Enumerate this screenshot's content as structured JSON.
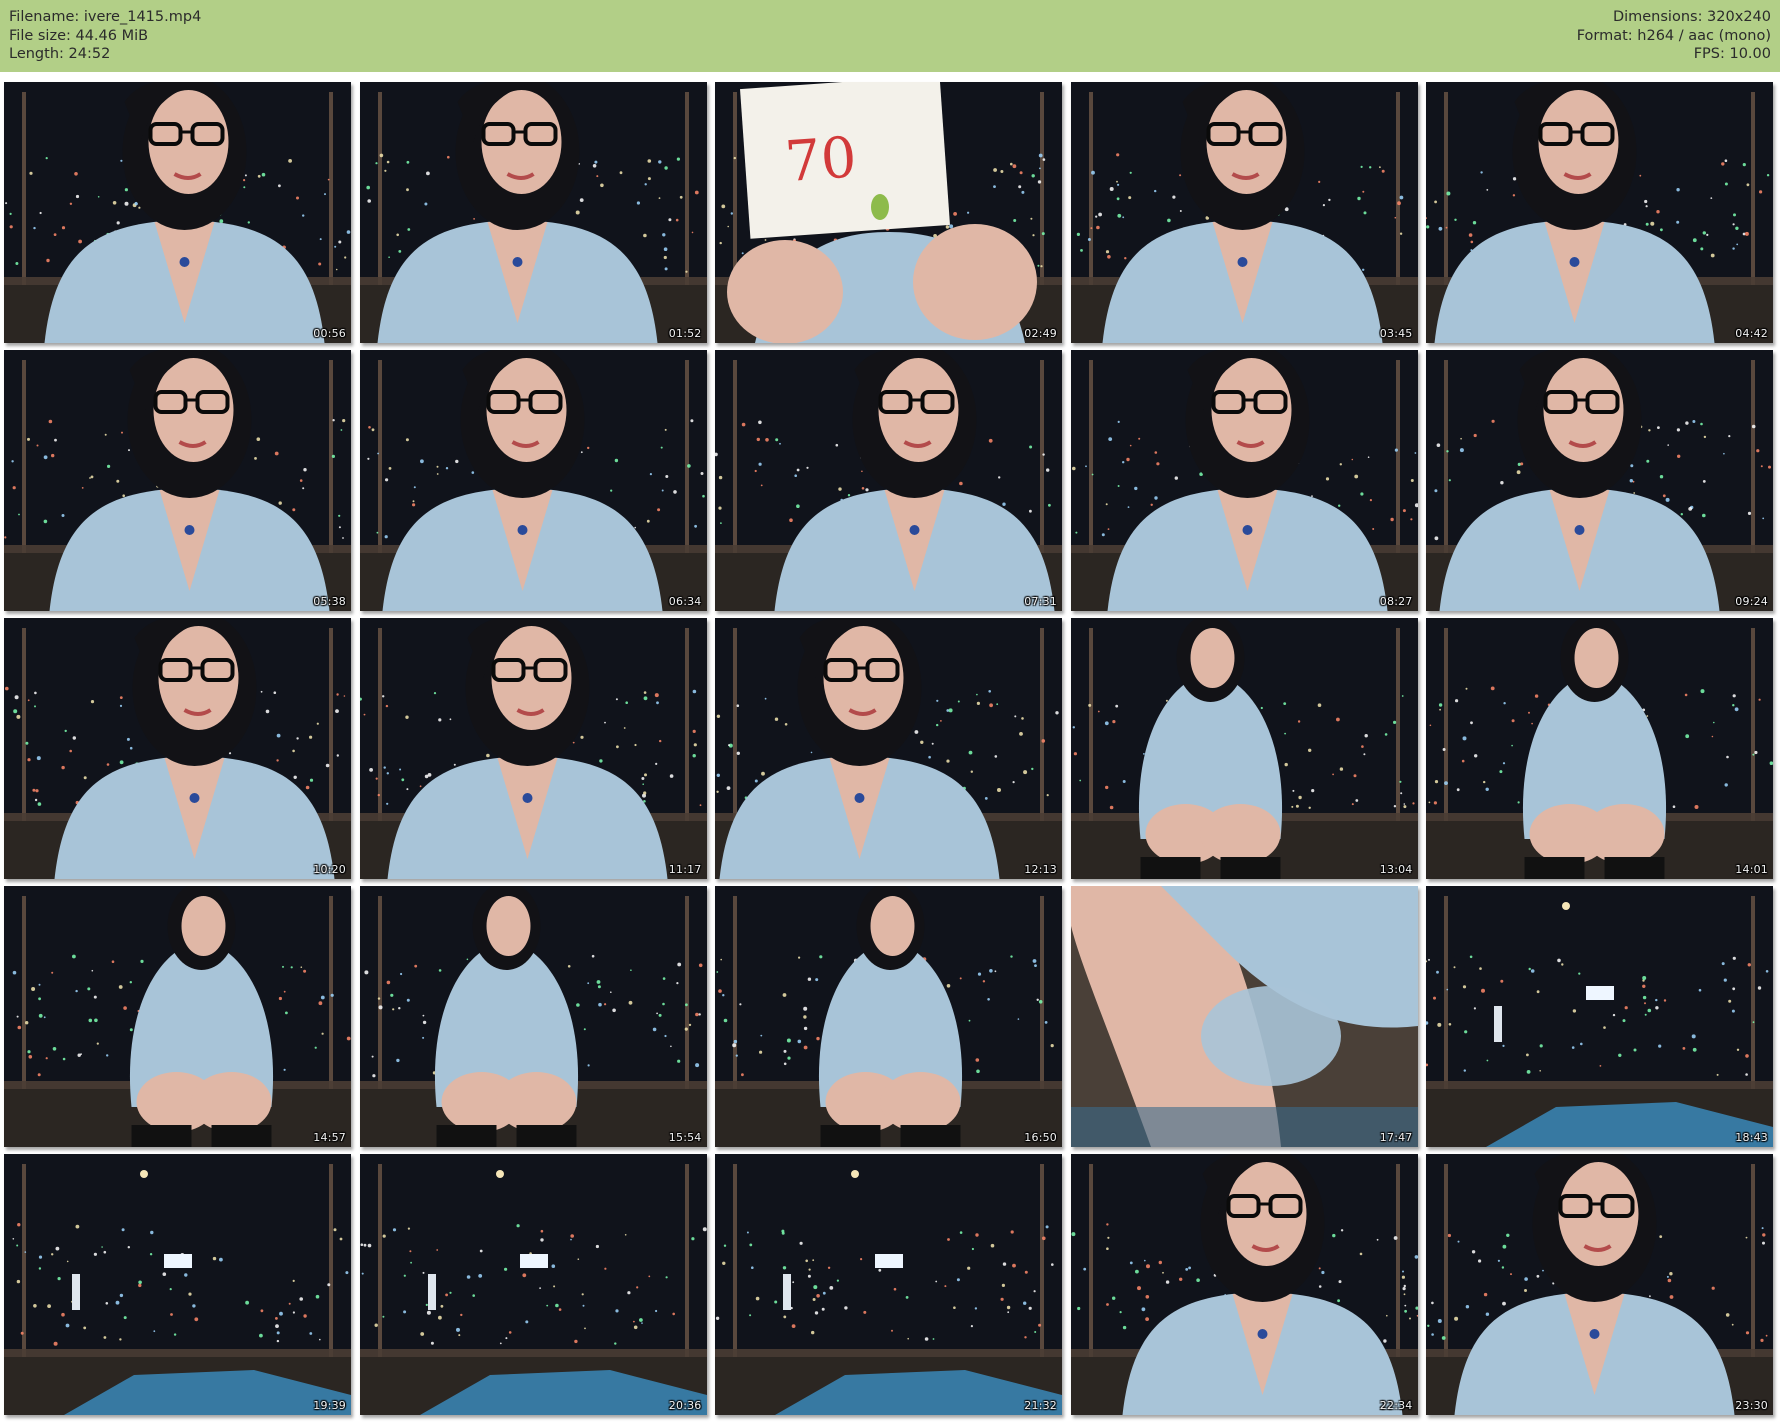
{
  "header": {
    "filename": "Filename: ivere_1415.mp4",
    "filesize": "File size: 44.46 MiB",
    "length": "Length: 24:52",
    "dimensions": "Dimensions: 320x240",
    "format": "Format: h264 / aac (mono)",
    "fps": "FPS: 10.00"
  },
  "colors": {
    "header_bg": "#b2cf87",
    "frame_bg_dark": "#141821",
    "shirt": "#a8c4d8",
    "skin": "#e0b7a6",
    "hair": "#121216"
  },
  "card_text": "70",
  "thumbnails": [
    {
      "time": "00:56",
      "scene": "portrait"
    },
    {
      "time": "01:52",
      "scene": "portrait"
    },
    {
      "time": "02:49",
      "scene": "card"
    },
    {
      "time": "03:45",
      "scene": "portrait"
    },
    {
      "time": "04:42",
      "scene": "portrait"
    },
    {
      "time": "05:38",
      "scene": "portrait"
    },
    {
      "time": "06:34",
      "scene": "portrait"
    },
    {
      "time": "07:31",
      "scene": "portrait"
    },
    {
      "time": "08:27",
      "scene": "portrait"
    },
    {
      "time": "09:24",
      "scene": "portrait"
    },
    {
      "time": "10:20",
      "scene": "portrait"
    },
    {
      "time": "11:17",
      "scene": "portrait"
    },
    {
      "time": "12:13",
      "scene": "portrait"
    },
    {
      "time": "13:04",
      "scene": "sitting"
    },
    {
      "time": "14:01",
      "scene": "sitting"
    },
    {
      "time": "14:57",
      "scene": "sitting"
    },
    {
      "time": "15:54",
      "scene": "sitting"
    },
    {
      "time": "16:50",
      "scene": "sitting"
    },
    {
      "time": "17:47",
      "scene": "closeup"
    },
    {
      "time": "18:43",
      "scene": "empty"
    },
    {
      "time": "19:39",
      "scene": "empty"
    },
    {
      "time": "20:36",
      "scene": "empty"
    },
    {
      "time": "21:32",
      "scene": "empty"
    },
    {
      "time": "22:34",
      "scene": "portrait"
    },
    {
      "time": "23:30",
      "scene": "portrait"
    }
  ]
}
